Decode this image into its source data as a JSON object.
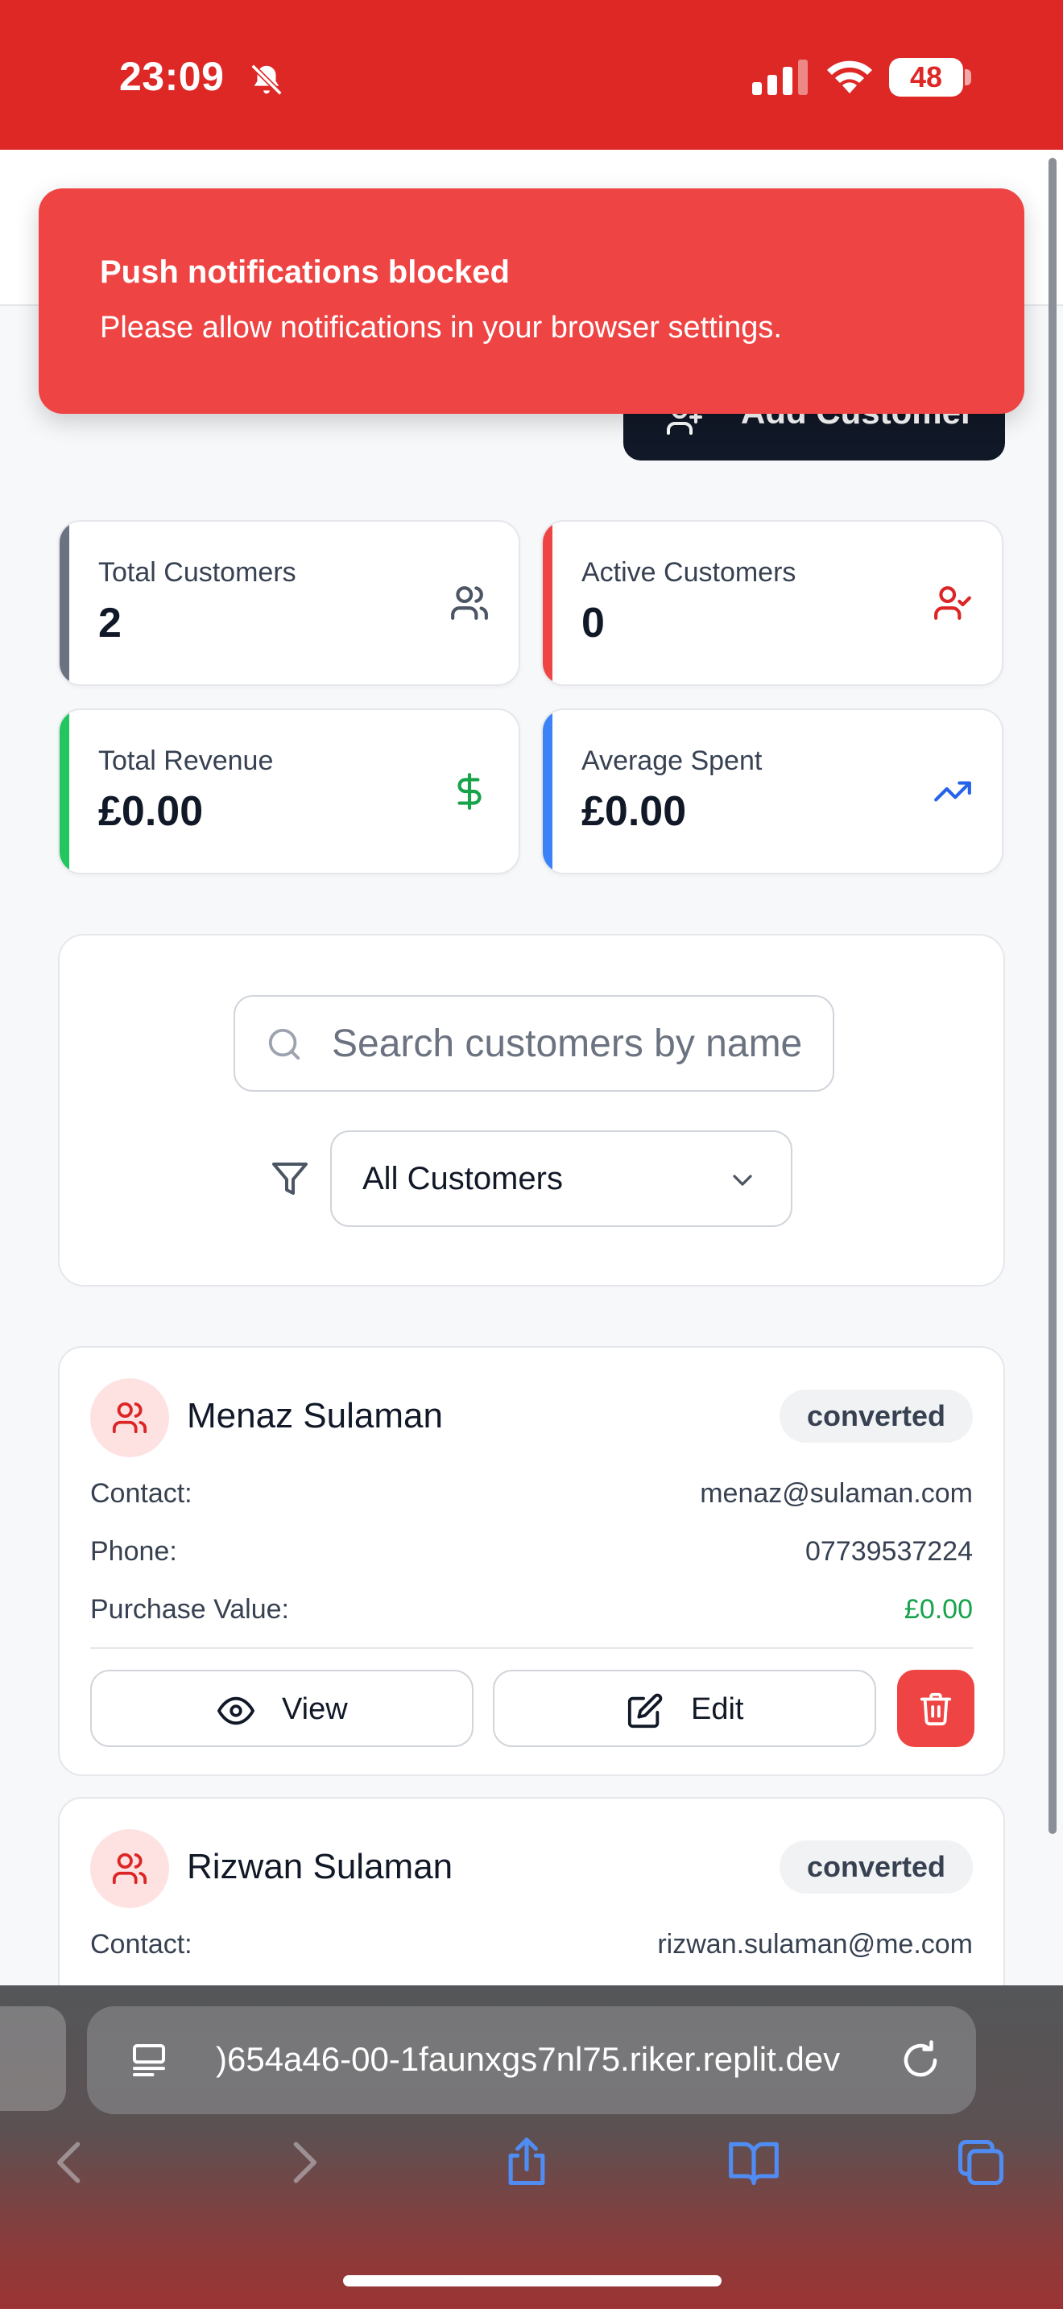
{
  "status_bar": {
    "time": "23:09",
    "battery": "48"
  },
  "toast": {
    "title": "Push notifications blocked",
    "message": "Please allow notifications in your browser settings."
  },
  "header": {
    "add_customer_label": "Add Customer"
  },
  "stats": [
    {
      "label": "Total Customers",
      "value": "2",
      "icon": "users-icon",
      "accent": "#6b7280"
    },
    {
      "label": "Active Customers",
      "value": "0",
      "icon": "user-check-icon",
      "accent": "#ef4444"
    },
    {
      "label": "Total Revenue",
      "value": "£0.00",
      "icon": "dollar-icon",
      "accent": "#22c55e"
    },
    {
      "label": "Average Spent",
      "value": "£0.00",
      "icon": "trending-up-icon",
      "accent": "#3b82f6"
    }
  ],
  "filters": {
    "search_placeholder": "Search customers by name",
    "select_value": "All Customers"
  },
  "customers": [
    {
      "name": "Menaz Sulaman",
      "status": "converted",
      "contact_label": "Contact:",
      "contact": "menaz@sulaman.com",
      "phone_label": "Phone:",
      "phone": "07739537224",
      "purchase_label": "Purchase Value:",
      "purchase": "£0.00"
    },
    {
      "name": "Rizwan Sulaman",
      "status": "converted",
      "contact_label": "Contact:",
      "contact": "rizwan.sulaman@me.com"
    }
  ],
  "actions": {
    "view": "View",
    "edit": "Edit"
  },
  "browser": {
    "url": ")654a46-00-1faunxgs7nl75.riker.replit.dev"
  },
  "colors": {
    "brand_red": "#dd2826",
    "toast_red": "#ef4444",
    "dark_button": "#111827",
    "success_green": "#16a34a"
  }
}
